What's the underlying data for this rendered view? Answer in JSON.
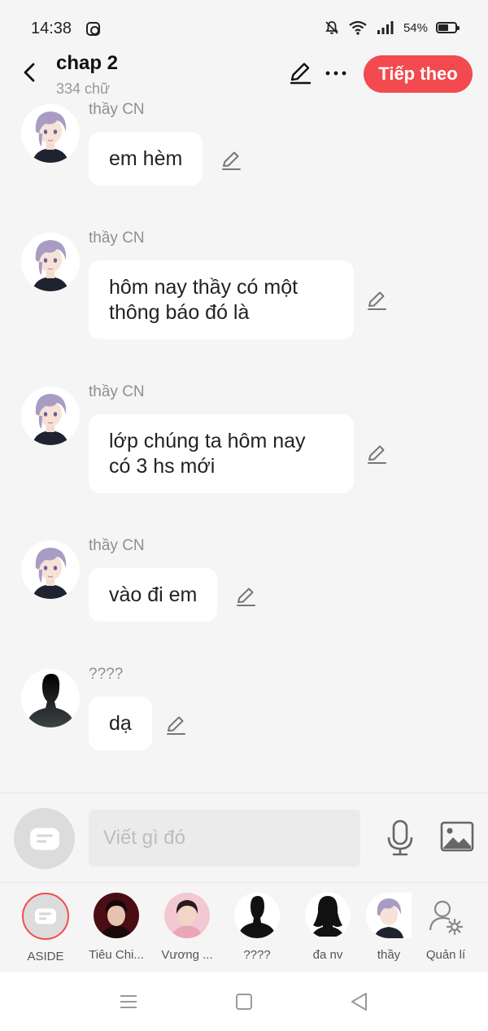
{
  "status": {
    "time": "14:38",
    "battery": "54%"
  },
  "header": {
    "title": "chap 2",
    "subtitle": "334 chữ",
    "next_label": "Tiếp theo"
  },
  "messages": [
    {
      "sender": "thầy CN",
      "text": "em hèm"
    },
    {
      "sender": "thầy CN",
      "text": "hôm nay thầy có một\nthông báo đó là"
    },
    {
      "sender": "thầy CN",
      "text": "lớp chúng ta hôm nay\ncó 3 hs mới"
    },
    {
      "sender": "thầy CN",
      "text": "vào đi em"
    },
    {
      "sender": "????",
      "text": "dạ"
    }
  ],
  "input": {
    "placeholder": "Viết gì đó"
  },
  "characters": [
    {
      "name": "ASIDE"
    },
    {
      "name": "Tiêu Chi..."
    },
    {
      "name": "Vương ..."
    },
    {
      "name": "????"
    },
    {
      "name": "đa nv"
    },
    {
      "name": "thầy"
    },
    {
      "name": "Quản lí"
    }
  ],
  "colors": {
    "accent": "#f24a4f",
    "background": "#f5f5f5"
  },
  "icons": [
    "back-arrow-icon",
    "pencil-icon",
    "more-icon",
    "microphone-icon",
    "image-icon",
    "chat-bubble-icon",
    "user-settings-icon"
  ]
}
